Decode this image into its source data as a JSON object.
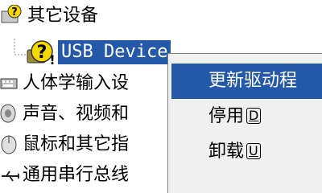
{
  "tree": {
    "other_devices": {
      "label": "其它设备",
      "icon": "question-device-icon"
    },
    "usb_device": {
      "label": "USB Device",
      "icon": "warning-question-icon",
      "selected": true
    },
    "hid": {
      "label": "人体学输入设",
      "icon": "keyboard-icon"
    },
    "sound": {
      "label": "声音、视频和",
      "icon": "speaker-icon"
    },
    "mouse": {
      "label": "鼠标和其它指",
      "icon": "mouse-icon"
    },
    "usb_bus": {
      "label": "通用串行总线",
      "icon": "usb-icon"
    }
  },
  "context_menu": {
    "items": [
      {
        "label": "更新驱动程",
        "highlighted": true
      },
      {
        "label": "停用",
        "accel": "D"
      },
      {
        "label": "卸载",
        "accel": "U"
      }
    ]
  },
  "colors": {
    "selection": "#2458a8",
    "warning_yellow": "#f5d800",
    "menu_bg": "#f0f0f0"
  }
}
